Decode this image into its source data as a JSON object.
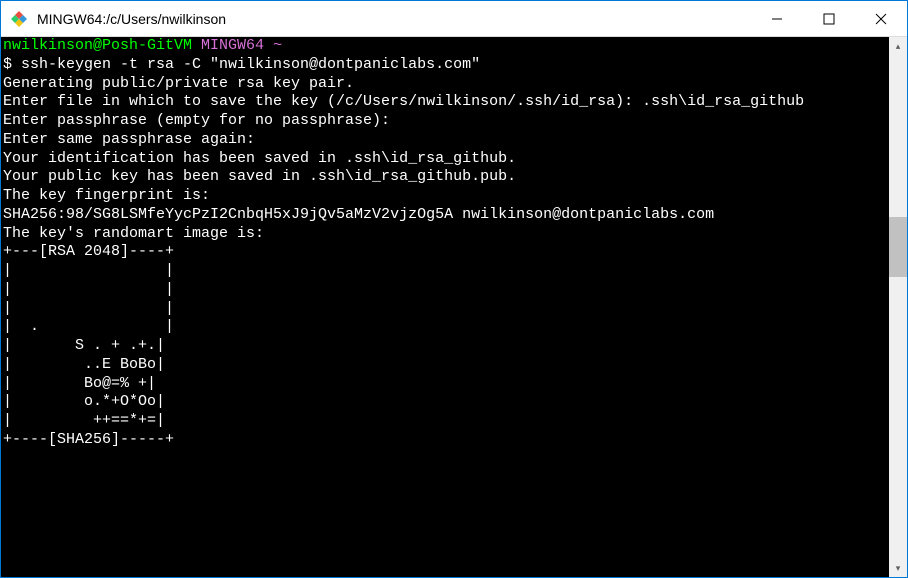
{
  "window": {
    "title": "MINGW64:/c/Users/nwilkinson"
  },
  "prompt": {
    "userhost": "nwilkinson@Posh-GitVM",
    "shell": "MINGW64",
    "path": "~"
  },
  "lines": {
    "cmd": "$ ssh-keygen -t rsa -C \"nwilkinson@dontpaniclabs.com\"",
    "l1": "Generating public/private rsa key pair.",
    "l2": "Enter file in which to save the key (/c/Users/nwilkinson/.ssh/id_rsa): .ssh\\id_rsa_github",
    "l3": "Enter passphrase (empty for no passphrase):",
    "l4": "Enter same passphrase again:",
    "l5": "Your identification has been saved in .ssh\\id_rsa_github.",
    "l6": "Your public key has been saved in .ssh\\id_rsa_github.pub.",
    "l7": "The key fingerprint is:",
    "l8": "SHA256:98/SG8LSMfeYycPzI2CnbqH5xJ9jQv5aMzV2vjzOg5A nwilkinson@dontpaniclabs.com",
    "l9": "The key's randomart image is:",
    "r0": "+---[RSA 2048]----+",
    "r1": "|                 |",
    "r2": "|                 |",
    "r3": "|                 |",
    "r4": "|  .              |",
    "r5": "|       S . + .+.|",
    "r6": "|        ..E BoBo|",
    "r7": "|        Bo@=% +|",
    "r8": "|        o.*+O*Oo|",
    "r9": "|         ++==*+=|",
    "r10": "+----[SHA256]-----+"
  }
}
